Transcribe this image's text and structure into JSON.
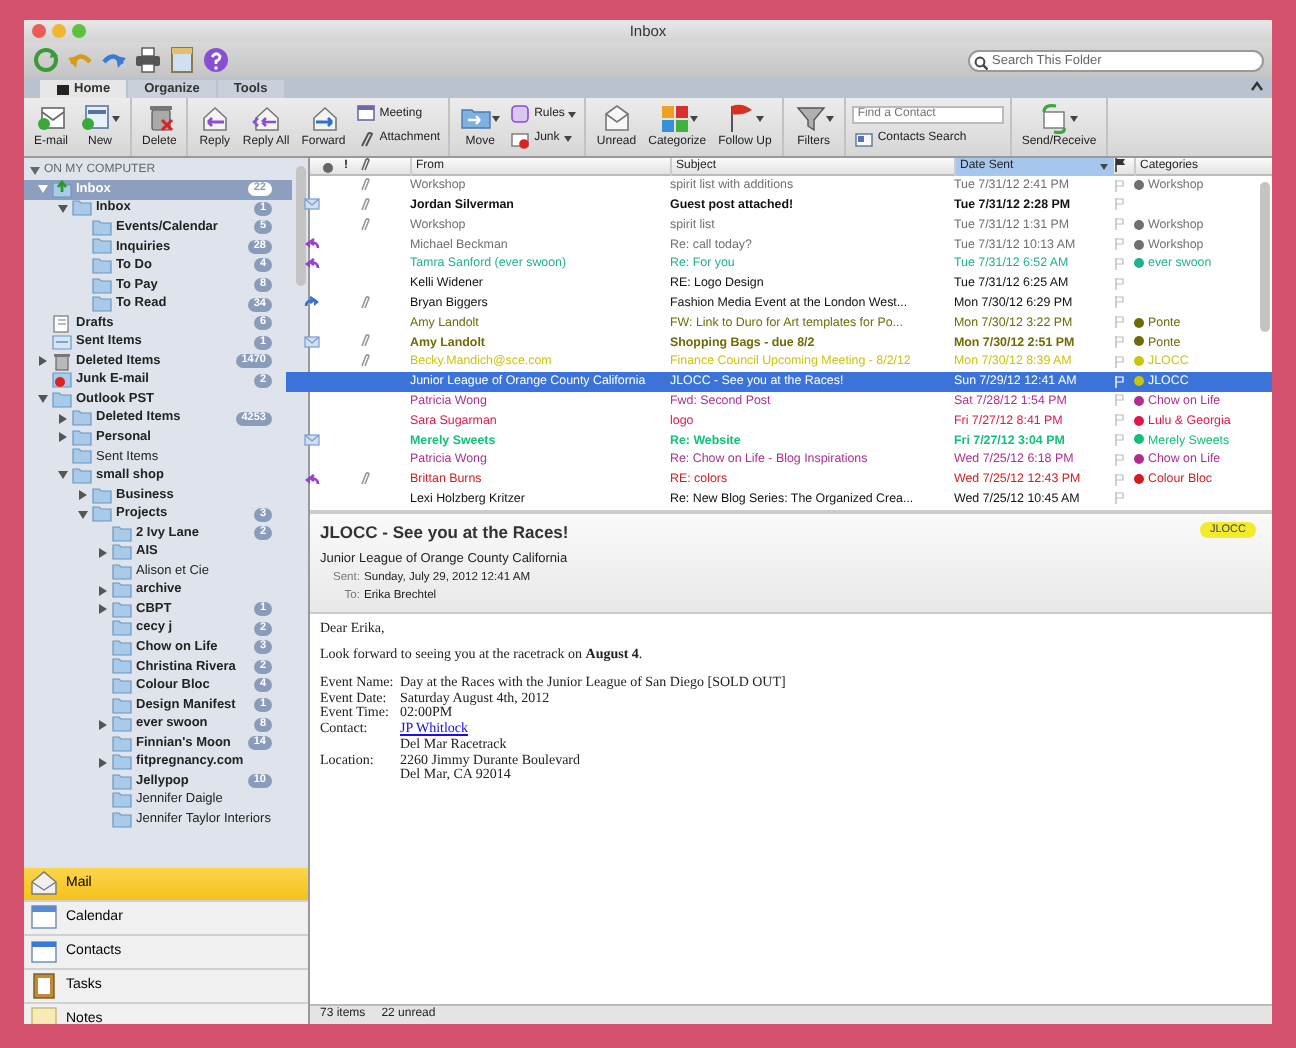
{
  "window": {
    "title": "Inbox"
  },
  "toolbar": {
    "search": {
      "placeholder": "Search This Folder"
    }
  },
  "tabs": [
    {
      "label": "Home",
      "selected": true
    },
    {
      "label": "Organize",
      "selected": false
    },
    {
      "label": "Tools",
      "selected": false
    }
  ],
  "ribbon": [
    {
      "items": [
        {
          "kind": "large",
          "label": "E-mail"
        },
        {
          "kind": "large",
          "label": "New",
          "dropdown": true
        }
      ]
    },
    {
      "items": [
        {
          "kind": "large",
          "label": "Delete"
        }
      ]
    },
    {
      "items": [
        {
          "kind": "large",
          "label": "Reply"
        },
        {
          "kind": "large",
          "label": "Reply All"
        },
        {
          "kind": "large",
          "label": "Forward"
        },
        {
          "kind": "stack",
          "items": [
            {
              "label": "Meeting"
            },
            {
              "label": "Attachment"
            }
          ]
        }
      ]
    },
    {
      "items": [
        {
          "kind": "large",
          "label": "Move",
          "dropdown": true
        },
        {
          "kind": "stack",
          "items": [
            {
              "label": "Rules",
              "dropdown": true
            },
            {
              "label": "Junk",
              "dropdown": true
            }
          ]
        }
      ]
    },
    {
      "items": [
        {
          "kind": "large",
          "label": "Unread"
        },
        {
          "kind": "large",
          "label": "Categorize",
          "dropdown": true
        },
        {
          "kind": "large",
          "label": "Follow Up",
          "dropdown": true
        }
      ]
    },
    {
      "items": [
        {
          "kind": "large",
          "label": "Filters",
          "dropdown": true
        }
      ]
    },
    {
      "items": [
        {
          "kind": "field",
          "placeholder": "Find a Contact",
          "label": "Contacts Search"
        }
      ]
    },
    {
      "items": [
        {
          "kind": "large",
          "label": "Send/Receive",
          "dropdown": true
        }
      ]
    }
  ],
  "sidebar": {
    "section": {
      "title": "ON MY COMPUTER",
      "expanded": true
    },
    "folders": [
      {
        "name": "Inbox",
        "kind": "inbox",
        "count": "22",
        "selected": true,
        "bold": true,
        "expanded": true,
        "children": [
          {
            "name": "Inbox",
            "kind": "folder",
            "count": "1",
            "selected": false,
            "bold": true,
            "expanded": true,
            "children": [
              {
                "name": "Events/Calendar",
                "kind": "folder",
                "count": "5",
                "selected": false,
                "bold": true
              },
              {
                "name": "Inquiries",
                "kind": "folder",
                "count": "28",
                "selected": false,
                "bold": true
              },
              {
                "name": "To Do",
                "kind": "folder",
                "count": "4",
                "selected": false,
                "bold": true
              },
              {
                "name": "To Pay",
                "kind": "folder",
                "count": "8",
                "selected": false,
                "bold": true
              },
              {
                "name": "To Read",
                "kind": "folder",
                "count": "34",
                "selected": false,
                "bold": true
              }
            ]
          }
        ]
      },
      {
        "name": "Drafts",
        "kind": "drafts",
        "count": "6",
        "selected": false,
        "bold": true
      },
      {
        "name": "Sent Items",
        "kind": "sent",
        "count": "1",
        "selected": false,
        "bold": true
      },
      {
        "name": "Deleted Items",
        "kind": "trash",
        "count": "1470",
        "selected": false,
        "bold": true,
        "expanded": false
      },
      {
        "name": "Junk E-mail",
        "kind": "junk",
        "count": "2",
        "selected": false,
        "bold": true
      },
      {
        "name": "Outlook PST",
        "kind": "folder",
        "selected": false,
        "bold": true,
        "expanded": true,
        "children": [
          {
            "name": "Deleted Items",
            "kind": "folder",
            "count": "4253",
            "selected": false,
            "bold": true,
            "expanded": false
          },
          {
            "name": "Personal",
            "kind": "folder",
            "selected": false,
            "bold": true,
            "expanded": false
          },
          {
            "name": "Sent Items",
            "kind": "folder",
            "selected": false,
            "bold": false
          },
          {
            "name": "small shop",
            "kind": "folder",
            "selected": false,
            "bold": true,
            "expanded": true,
            "children": [
              {
                "name": "Business",
                "kind": "folder",
                "selected": false,
                "bold": true,
                "expanded": false
              },
              {
                "name": "Projects",
                "kind": "folder",
                "count": "3",
                "selected": false,
                "bold": true,
                "expanded": true,
                "children": [
                  {
                    "name": "2 Ivy Lane",
                    "kind": "folder",
                    "count": "2",
                    "selected": false,
                    "bold": true
                  },
                  {
                    "name": "AIS",
                    "kind": "folder",
                    "selected": false,
                    "bold": true,
                    "expanded": false
                  },
                  {
                    "name": "Alison et Cie",
                    "kind": "folder",
                    "selected": false,
                    "bold": false
                  },
                  {
                    "name": "archive",
                    "kind": "folder",
                    "selected": false,
                    "bold": true,
                    "expanded": false
                  },
                  {
                    "name": "CBPT",
                    "kind": "folder",
                    "count": "1",
                    "selected": false,
                    "bold": true,
                    "expanded": false
                  },
                  {
                    "name": "cecy j",
                    "kind": "folder",
                    "count": "2",
                    "selected": false,
                    "bold": true
                  },
                  {
                    "name": "Chow on Life",
                    "kind": "folder",
                    "count": "3",
                    "selected": false,
                    "bold": true
                  },
                  {
                    "name": "Christina Rivera",
                    "kind": "folder",
                    "count": "2",
                    "selected": false,
                    "bold": true
                  },
                  {
                    "name": "Colour Bloc",
                    "kind": "folder",
                    "count": "4",
                    "selected": false,
                    "bold": true
                  },
                  {
                    "name": "Design Manifest",
                    "kind": "folder",
                    "count": "1",
                    "selected": false,
                    "bold": true
                  },
                  {
                    "name": "ever swoon",
                    "kind": "folder",
                    "count": "8",
                    "selected": false,
                    "bold": true,
                    "expanded": false
                  },
                  {
                    "name": "Finnian's Moon",
                    "kind": "folder",
                    "count": "14",
                    "selected": false,
                    "bold": true
                  },
                  {
                    "name": "fitpregnancy.com",
                    "kind": "folder",
                    "selected": false,
                    "bold": true,
                    "expanded": false
                  },
                  {
                    "name": "Jellypop",
                    "kind": "folder",
                    "count": "10",
                    "selected": false,
                    "bold": true
                  },
                  {
                    "name": "Jennifer Daigle",
                    "kind": "folder",
                    "selected": false,
                    "bold": false
                  },
                  {
                    "name": "Jennifer Taylor Interiors",
                    "kind": "folder",
                    "selected": false,
                    "bold": false
                  }
                ]
              }
            ]
          }
        ]
      }
    ],
    "nav": [
      {
        "label": "Mail",
        "selected": true
      },
      {
        "label": "Calendar",
        "selected": false
      },
      {
        "label": "Contacts",
        "selected": false
      },
      {
        "label": "Tasks",
        "selected": false
      },
      {
        "label": "Notes",
        "selected": false
      }
    ]
  },
  "message_list": {
    "columns": [
      {
        "label": "!",
        "kind": "mark",
        "sorted": false
      },
      {
        "label": "From",
        "kind": "text",
        "sorted": false
      },
      {
        "label": "Subject",
        "kind": "text",
        "sorted": false
      },
      {
        "label": "Date Sent",
        "kind": "text",
        "sorted": true
      },
      {
        "label": "Categories",
        "kind": "text",
        "sorted": false
      }
    ],
    "rows": [
      {
        "kind": "plain",
        "attachment": true,
        "from": "Workshop",
        "subject": "spirit list with additions",
        "date": "Tue 7/31/12 2:41 PM",
        "category": {
          "name": "Workshop",
          "color": "#707070"
        },
        "unread": false,
        "selected": false
      },
      {
        "kind": "envelope",
        "attachment": true,
        "from": "Jordan Silverman",
        "subject": "Guest post attached!",
        "date": "Tue 7/31/12 2:28 PM",
        "unread": true,
        "selected": false
      },
      {
        "kind": "plain",
        "attachment": true,
        "from": "Workshop",
        "subject": "spirit list",
        "date": "Tue 7/31/12 1:31 PM",
        "category": {
          "name": "Workshop",
          "color": "#707070"
        },
        "unread": false,
        "selected": false
      },
      {
        "kind": "replied",
        "attachment": false,
        "from": "Michael Beckman",
        "subject": "Re: call today?",
        "date": "Tue 7/31/12 10:13 AM",
        "category": {
          "name": "Workshop",
          "color": "#707070"
        },
        "unread": false,
        "selected": false
      },
      {
        "kind": "replied",
        "attachment": false,
        "from": "Tamra Sanford (ever swoon)",
        "subject": "Re: For you",
        "date": "Tue 7/31/12 6:52 AM",
        "category": {
          "name": "ever swoon",
          "color": "#22b093"
        },
        "unread": false,
        "selected": false
      },
      {
        "kind": "plain",
        "attachment": false,
        "from": "Kelli Widener",
        "subject": "RE: Logo Design",
        "date": "Tue 7/31/12 6:25 AM",
        "unread": false,
        "selected": false
      },
      {
        "kind": "forwarded",
        "attachment": true,
        "from": "Bryan Biggers",
        "subject": "Fashion Media Event at the London West...",
        "date": "Mon 7/30/12 6:29 PM",
        "unread": false,
        "selected": false
      },
      {
        "kind": "plain",
        "attachment": false,
        "from": "Amy Landolt",
        "subject": "FW: Link to Duro for Art templates for Po...",
        "date": "Mon 7/30/12 3:22 PM",
        "category": {
          "name": "Ponte",
          "color": "#6f6a06"
        },
        "unread": false,
        "selected": false
      },
      {
        "kind": "envelope",
        "attachment": true,
        "from": "Amy Landolt",
        "subject": "Shopping Bags - due 8/2",
        "date": "Mon 7/30/12 2:51 PM",
        "category": {
          "name": "Ponte",
          "color": "#6f6a06"
        },
        "unread": true,
        "selected": false
      },
      {
        "kind": "plain",
        "attachment": true,
        "from": "Becky.Mandich@sce.com",
        "subject": "Finance Council Upcoming Meeting - 8/2/12",
        "date": "Mon 7/30/12 8:39 AM",
        "category": {
          "name": "JLOCC",
          "color": "#c9c50c"
        },
        "unread": false,
        "selected": false
      },
      {
        "kind": "plain",
        "attachment": false,
        "from": "Junior League of Orange County California",
        "subject": "JLOCC - See you at the Races!",
        "date": "Sun 7/29/12 12:41 AM",
        "category": {
          "name": "JLOCC",
          "color": "#c9c50c"
        },
        "unread": false,
        "selected": true
      },
      {
        "kind": "plain",
        "attachment": false,
        "from": "Patricia Wong",
        "subject": "Fwd: Second Post",
        "date": "Sat 7/28/12 1:54 PM",
        "category": {
          "name": "Chow on Life",
          "color": "#b02f8c"
        },
        "unread": false,
        "selected": false
      },
      {
        "kind": "plain",
        "attachment": false,
        "from": "Sara Sugarman",
        "subject": "logo",
        "date": "Fri 7/27/12 8:41 PM",
        "category": {
          "name": "Lulu & Georgia",
          "color": "#e0184a"
        },
        "unread": false,
        "selected": false
      },
      {
        "kind": "envelope",
        "attachment": false,
        "from": "Merely Sweets",
        "subject": "Re: Website",
        "date": "Fri 7/27/12 3:04 PM",
        "category": {
          "name": "Merely Sweets",
          "color": "#12c07c"
        },
        "unread": true,
        "selected": false
      },
      {
        "kind": "plain",
        "attachment": false,
        "from": "Patricia Wong",
        "subject": "Re: Chow on Life - Blog Inspirations",
        "date": "Wed 7/25/12 6:18 PM",
        "category": {
          "name": "Chow on Life",
          "color": "#b02f8c"
        },
        "unread": false,
        "selected": false
      },
      {
        "kind": "replied",
        "attachment": true,
        "from": "Brittan Burns",
        "subject": "RE: colors",
        "date": "Wed 7/25/12 12:43 PM",
        "category": {
          "name": "Colour Bloc",
          "color": "#d41c1c"
        },
        "unread": false,
        "selected": false
      },
      {
        "kind": "plain",
        "attachment": false,
        "from": "Lexi Holzberg Kritzer",
        "subject": "Re: New Blog Series: The Organized Crea...",
        "date": "Wed 7/25/12 10:45 AM",
        "unread": false,
        "selected": false
      }
    ]
  },
  "reading_pane": {
    "subject": "JLOCC - See you at the Races!",
    "sender": "Junior League of Orange County California",
    "category": {
      "name": "JLOCC",
      "color": "#f2ea2a"
    },
    "sent_label": "Sent:",
    "sent": "Sunday, July 29, 2012 12:41 AM",
    "to_label": "To:",
    "to": "Erika Brechtel",
    "body": {
      "greeting": "Dear Erika,",
      "paragraph": "Look forward to seeing you at the racetrack on **August 4**.",
      "details": [
        {
          "label": "Event Name:",
          "value": "Day at the Races with the Junior League of San Diego [SOLD OUT]",
          "kind": "text"
        },
        {
          "label": "Event Date:",
          "value": "Saturday August 4th, 2012",
          "kind": "text"
        },
        {
          "label": "Event Time:",
          "value": "02:00PM",
          "kind": "text"
        },
        {
          "label": "Contact:",
          "value": "JP Whitlock",
          "kind": "link"
        },
        {
          "value": "Del Mar Racetrack",
          "kind": "text"
        },
        {
          "label": "Location:",
          "value": "2260 Jimmy Durante Boulevard",
          "kind": "text"
        },
        {
          "value": "Del Mar, CA 92014",
          "kind": "text"
        }
      ]
    }
  },
  "status_bar": {
    "items": "73 items",
    "unread": "22 unread"
  }
}
